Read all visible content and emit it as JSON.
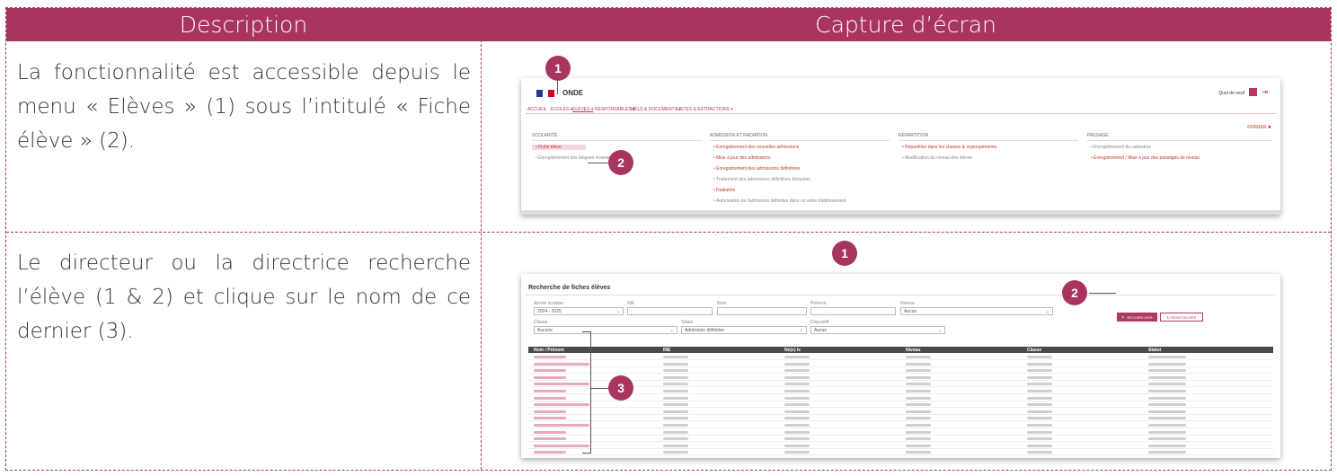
{
  "header": {
    "description": "Description",
    "capture": "Capture d’écran"
  },
  "rows": [
    {
      "text": "La fonctionnalité est accessible depuis le menu « Elèves » (1) sous l’intitulé « Fiche élève » (2)."
    },
    {
      "text": "Le directeur ou la directrice recherche l’élève (1 & 2) et clique sur le nom de ce dernier (3)."
    }
  ],
  "shot1": {
    "brand": "ONDE",
    "top_right": "Quoi de neuf",
    "menu": [
      "ACCUEIL",
      "ÉCOLES ▾",
      "ÉLÈVES ▾",
      "RESPONSABLES ▾",
      "MÉLS & DOCUMENTS ▾",
      "LISTES & EXTRACTIONS ▾"
    ],
    "close": "FERMER ✖",
    "columns": [
      {
        "title": "SCOLARITÉ",
        "items": [
          "• Fiche élève",
          "• Enregistrement des langues vivantes"
        ]
      },
      {
        "title": "ADMISSION ET RADIATION",
        "items": [
          "• Enregistrement des nouvelles admissions",
          "• Mise à jour des admissions",
          "• Enregistrement des admissions définitives",
          "• Traitement des admissions définitives bloquées",
          "• Radiation",
          "• Autorisation de l'admission définitive dans un autre établissement"
        ]
      },
      {
        "title": "RÉPARTITION",
        "items": [
          "• Répartition dans les classes & regroupements",
          "• Modification du niveau des élèves"
        ]
      },
      {
        "title": "PASSAGE",
        "items": [
          "• Enregistrement du calendrier",
          "• Enregistrement / Mise à jour des passages de niveau"
        ]
      }
    ],
    "markers": [
      "1",
      "2"
    ]
  },
  "shot2": {
    "title": "Recherche de fiches élèves",
    "fields": {
      "annee_label": "Année scolaire",
      "annee_value": "2024 - 2025",
      "ine_label": "INE",
      "nom_label": "Nom",
      "prenom_label": "Prénom",
      "niveau_label": "Niveau",
      "niveau_value": "Aucun",
      "classe_label": "Classe",
      "classe_value": "Aucune",
      "statut_label": "Statut",
      "statut_value": "Admission définitive",
      "dispositif_label": "Dispositif",
      "dispositif_value": "Aucun"
    },
    "buttons": {
      "search": "🔍 RECHERCHER",
      "reset": "↻ RÉINITIALISER"
    },
    "table_headers": [
      "Nom / Prénom",
      "INE",
      "Né(e) le",
      "Niveau",
      "Classe",
      "Statut"
    ],
    "markers": [
      "1",
      "2",
      "3"
    ]
  },
  "colors": {
    "accent": "#a8345f"
  }
}
